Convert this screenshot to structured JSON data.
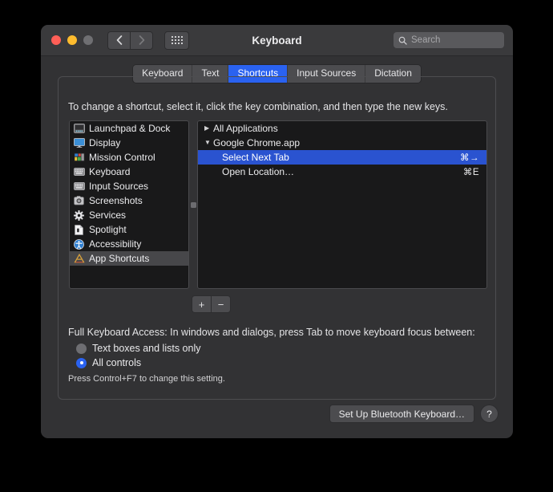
{
  "window": {
    "title": "Keyboard",
    "traffic_lights": [
      "close",
      "minimize",
      "zoom"
    ],
    "nav_back": "‹",
    "nav_forward": "›",
    "grid_button": "show-all-icon"
  },
  "search": {
    "placeholder": "Search",
    "value": "",
    "icon": "search-icon"
  },
  "tabs": [
    {
      "label": "Keyboard",
      "active": false
    },
    {
      "label": "Text",
      "active": false
    },
    {
      "label": "Shortcuts",
      "active": true
    },
    {
      "label": "Input Sources",
      "active": false
    },
    {
      "label": "Dictation",
      "active": false
    }
  ],
  "main": {
    "hint": "To change a shortcut, select it, click the key combination, and then type the new keys."
  },
  "categories": [
    {
      "label": "Launchpad & Dock",
      "icon": "launchpad-dock-icon",
      "selected": false
    },
    {
      "label": "Display",
      "icon": "display-icon",
      "selected": false
    },
    {
      "label": "Mission Control",
      "icon": "mission-control-icon",
      "selected": false
    },
    {
      "label": "Keyboard",
      "icon": "keyboard-icon",
      "selected": false
    },
    {
      "label": "Input Sources",
      "icon": "input-sources-icon",
      "selected": false
    },
    {
      "label": "Screenshots",
      "icon": "screenshots-icon",
      "selected": false
    },
    {
      "label": "Services",
      "icon": "services-gear-icon",
      "selected": false
    },
    {
      "label": "Spotlight",
      "icon": "spotlight-doc-icon",
      "selected": false
    },
    {
      "label": "Accessibility",
      "icon": "accessibility-icon",
      "selected": false
    },
    {
      "label": "App Shortcuts",
      "icon": "app-shortcuts-icon",
      "selected": true
    }
  ],
  "shortcuts": [
    {
      "label": "All Applications",
      "key": "",
      "type": "group",
      "expanded": false,
      "triangle": "▶",
      "selected": false
    },
    {
      "label": "Google Chrome.app",
      "key": "",
      "type": "group",
      "expanded": true,
      "triangle": "▼",
      "selected": false
    },
    {
      "label": "Select Next Tab",
      "key": "⌘→",
      "type": "item",
      "selected": true
    },
    {
      "label": "Open Location…",
      "key": "⌘E",
      "type": "item",
      "selected": false
    }
  ],
  "list_buttons": {
    "add": "+",
    "remove": "−"
  },
  "full_keyboard_access": {
    "title": "Full Keyboard Access: In windows and dialogs, press Tab to move keyboard focus between:",
    "options": [
      {
        "label": "Text boxes and lists only",
        "selected": false
      },
      {
        "label": "All controls",
        "selected": true
      }
    ],
    "note": "Press Control+F7 to change this setting."
  },
  "footer": {
    "bluetooth_button": "Set Up Bluetooth Keyboard…",
    "help_button": "?"
  },
  "colors": {
    "accent_blue": "#2a62f0",
    "selection_blue": "#2a53d0",
    "window_bg": "#323234",
    "titlebar_bg": "#3a3a3c",
    "list_bg": "#19191a",
    "close_red": "#ff5f57",
    "min_yellow": "#febc2e",
    "zoom_gray": "#6f6f72"
  }
}
